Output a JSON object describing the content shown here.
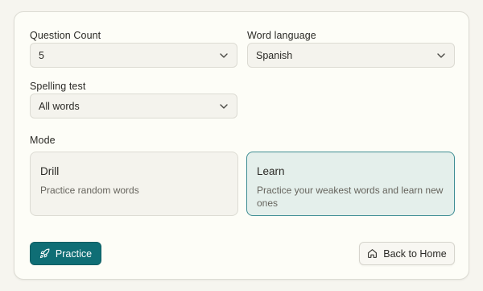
{
  "form": {
    "question_count": {
      "label": "Question Count",
      "value": "5"
    },
    "word_language": {
      "label": "Word language",
      "value": "Spanish"
    },
    "spelling_test": {
      "label": "Spelling test",
      "value": "All words"
    }
  },
  "mode": {
    "label": "Mode",
    "selected": "Learn",
    "options": [
      {
        "title": "Drill",
        "description": "Practice random words"
      },
      {
        "title": "Learn",
        "description": "Practice your weakest words and learn new ones"
      }
    ]
  },
  "actions": {
    "practice_label": "Practice",
    "back_label": "Back to Home"
  },
  "icons": {
    "practice": "rocket-icon",
    "back": "home-icon",
    "select": "chevron-down-icon"
  },
  "colors": {
    "accent": "#0f6e75",
    "selected_bg": "#e4efeb",
    "selected_border": "#3f8e93",
    "page_bg": "#f6f5ef",
    "card_bg": "#fdfdf7"
  }
}
